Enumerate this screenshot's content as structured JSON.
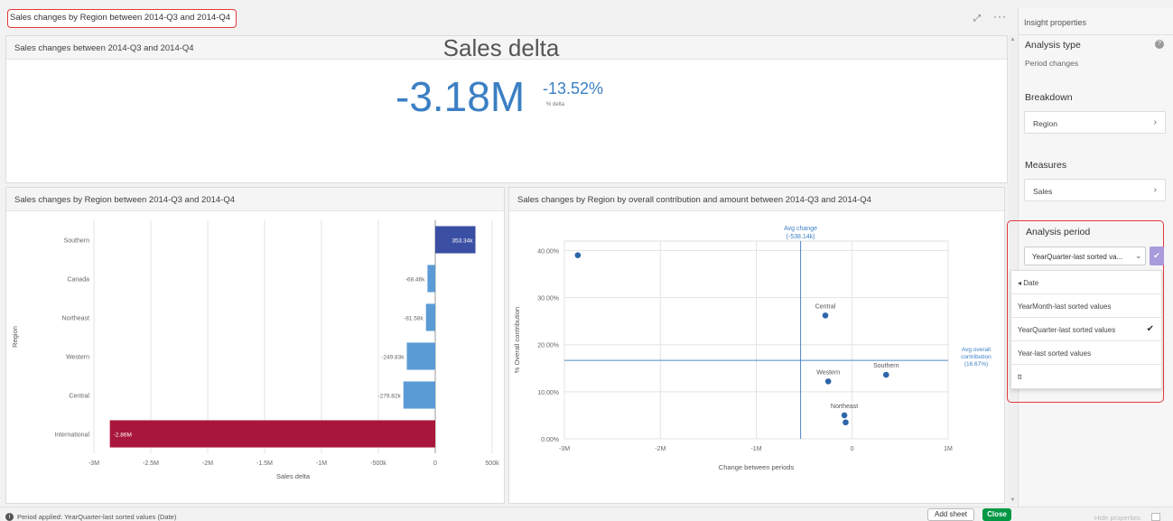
{
  "header": {
    "title": "Sales changes by Region between 2014-Q3 and 2014-Q4",
    "expand_icon": "expand-icon",
    "more_icon": "more-icon"
  },
  "kpi_panel": {
    "header": "Sales changes between 2014-Q3 and 2014-Q4",
    "title": "Sales delta",
    "value": "-3.18M",
    "percent": "-13.52%",
    "percent_label": "% delta",
    "color": "#3b7fc4"
  },
  "bar_panel": {
    "header": "Sales changes by Region between 2014-Q3 and 2014-Q4"
  },
  "scatter_panel": {
    "header": "Sales changes by Region by overall contribution and amount between 2014-Q3 and 2014-Q4"
  },
  "chart_data": [
    {
      "type": "bar",
      "orientation": "horizontal",
      "title": "Sales changes by Region between 2014-Q3 and 2014-Q4",
      "xlabel": "Sales delta",
      "ylabel": "Region",
      "categories": [
        "Southern",
        "Canada",
        "Northeast",
        "Western",
        "Central",
        "International"
      ],
      "values": [
        353340,
        -68460,
        -81580,
        -249830,
        -279820,
        -2860000
      ],
      "data_labels": [
        "353.34k",
        "-68.46k",
        "-81.58k",
        "-249.83k",
        "-279.82k",
        "-2.86M"
      ],
      "xlim": [
        -3000000,
        500000
      ],
      "xticks": [
        -3000000,
        -2500000,
        -2000000,
        -1500000,
        -1000000,
        -500000,
        0,
        500000
      ],
      "xtick_labels": [
        "-3M",
        "-2.5M",
        "-2M",
        "-1.5M",
        "-1M",
        "-500k",
        "0",
        "500k"
      ],
      "colors": {
        "positive": "#3a4fa3",
        "negative": "#5b9bd5",
        "largest_negative": "#a8173b"
      },
      "grid": "vertical"
    },
    {
      "type": "scatter",
      "title": "Sales changes by Region by overall contribution and amount between 2014-Q3 and 2014-Q4",
      "xlabel": "Change between periods",
      "ylabel": "% Overall contribution",
      "xlim": [
        -3000000,
        1000000
      ],
      "ylim": [
        0,
        0.42
      ],
      "xticks": [
        -3000000,
        -2000000,
        -1000000,
        0,
        1000000
      ],
      "xtick_labels": [
        "-3M",
        "-2M",
        "-1M",
        "0",
        "1M"
      ],
      "yticks": [
        0,
        0.1,
        0.2,
        0.3,
        0.4
      ],
      "ytick_labels": [
        "0.00%",
        "10.00%",
        "20.00%",
        "30.00%",
        "40.00%"
      ],
      "points": [
        {
          "label": "",
          "x": -2860000,
          "y": 0.39
        },
        {
          "label": "Central",
          "x": -279820,
          "y": 0.262
        },
        {
          "label": "Western",
          "x": -249830,
          "y": 0.122
        },
        {
          "label": "Southern",
          "x": 353340,
          "y": 0.136
        },
        {
          "label": "Northeast",
          "x": -81580,
          "y": 0.05
        },
        {
          "label": "",
          "x": -68460,
          "y": 0.035
        }
      ],
      "reference_lines": {
        "avg_change": {
          "value": -538140,
          "label_1": "Avg change",
          "label_2": "(-538.14k)"
        },
        "avg_contribution": {
          "value": 0.1667,
          "label_1": "Avg overall",
          "label_2": "contribution",
          "label_3": "(16.67%)"
        }
      },
      "point_color": "#2d66a8",
      "grid": "both"
    }
  ],
  "scrollbar": {
    "up": "▲",
    "down": "▼"
  },
  "bottom": {
    "period_applied": "Period applied: YearQuarter-last sorted values (Date)",
    "add_sheet": "Add sheet",
    "close": "Close",
    "hide_properties": "Hide properties"
  },
  "properties": {
    "title": "Insight properties",
    "analysis_type_label": "Analysis type",
    "analysis_type_value": "Period changes",
    "breakdown_label": "Breakdown",
    "breakdown_value": "Region",
    "measures_label": "Measures",
    "measures_value": "Sales",
    "analysis_period_label": "Analysis period",
    "period_selected": "YearQuarter-last sorted va...",
    "dropdown_back": "Date",
    "dropdown_items": [
      "YearMonth-last sorted values",
      "YearQuarter-last sorted values",
      "Year-last sorted values",
      "tt"
    ],
    "accent_color": "#a99bdc",
    "highlight_color": "#e23a3a"
  }
}
